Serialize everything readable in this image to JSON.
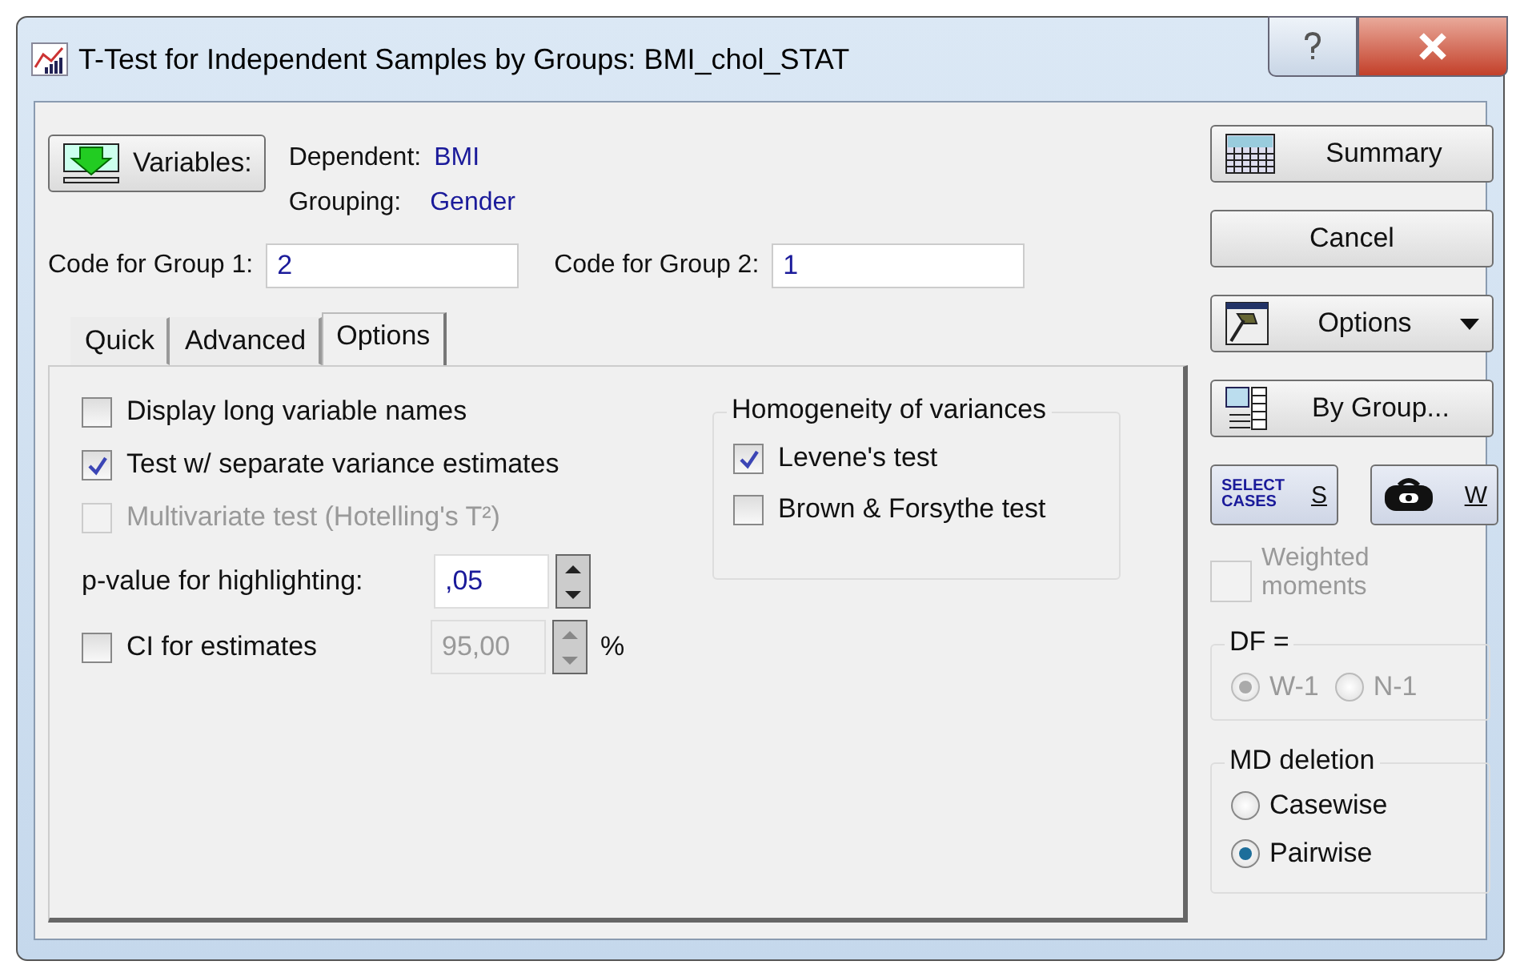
{
  "window": {
    "title": "T-Test for Independent Samples by Groups: BMI_chol_STAT"
  },
  "variables": {
    "button": "Variables:",
    "dependent_label": "Dependent:",
    "dependent": "BMI",
    "grouping_label": "Grouping:",
    "grouping": "Gender"
  },
  "codes": [
    {
      "label": "Code for Group 1:",
      "value": "2"
    },
    {
      "label": "Code for Group 2:",
      "value": "1"
    }
  ],
  "tabs": [
    {
      "label": "Quick",
      "selected": false
    },
    {
      "label": "Advanced",
      "selected": false
    },
    {
      "label": "Options",
      "selected": true
    }
  ],
  "options": {
    "checkboxes": [
      {
        "label": "Display long variable names",
        "checked": false,
        "disabled": false
      },
      {
        "label": "Test w/ separate variance estimates",
        "checked": true,
        "disabled": false
      },
      {
        "label": "Multivariate test (Hotelling's T²)",
        "checked": false,
        "disabled": true
      }
    ],
    "p_value": {
      "label": "p-value for highlighting:",
      "value": ",05",
      "disabled": false
    },
    "ci": {
      "label": "CI for estimates",
      "checked": false,
      "value": "95,00",
      "unit": "%",
      "disabled": true
    },
    "homogeneity": {
      "title": "Homogeneity of variances",
      "checkboxes": [
        {
          "label": "Levene's test",
          "checked": true,
          "disabled": false
        },
        {
          "label": "Brown & Forsythe test",
          "checked": false,
          "disabled": false
        }
      ]
    }
  },
  "side": {
    "buttons": [
      {
        "kind": "summary",
        "label": "Summary"
      },
      {
        "kind": "plain",
        "label": "Cancel"
      },
      {
        "kind": "options",
        "label": "Options"
      },
      {
        "kind": "bygroup",
        "label": "By Group..."
      }
    ],
    "select_cases": {
      "icon_text": "SELECT CASES",
      "label": "S"
    },
    "weight": {
      "label": "W"
    },
    "weighted_moments": {
      "label": "Weighted moments",
      "checked": false,
      "disabled": true
    },
    "df": {
      "title": "DF =",
      "disabled": true,
      "options": [
        {
          "label": "W-1",
          "selected": true
        },
        {
          "label": "N-1",
          "selected": false
        }
      ]
    },
    "md_deletion": {
      "title": "MD deletion",
      "disabled": false,
      "options": [
        {
          "label": "Casewise",
          "selected": false
        },
        {
          "label": "Pairwise",
          "selected": true
        }
      ]
    }
  }
}
